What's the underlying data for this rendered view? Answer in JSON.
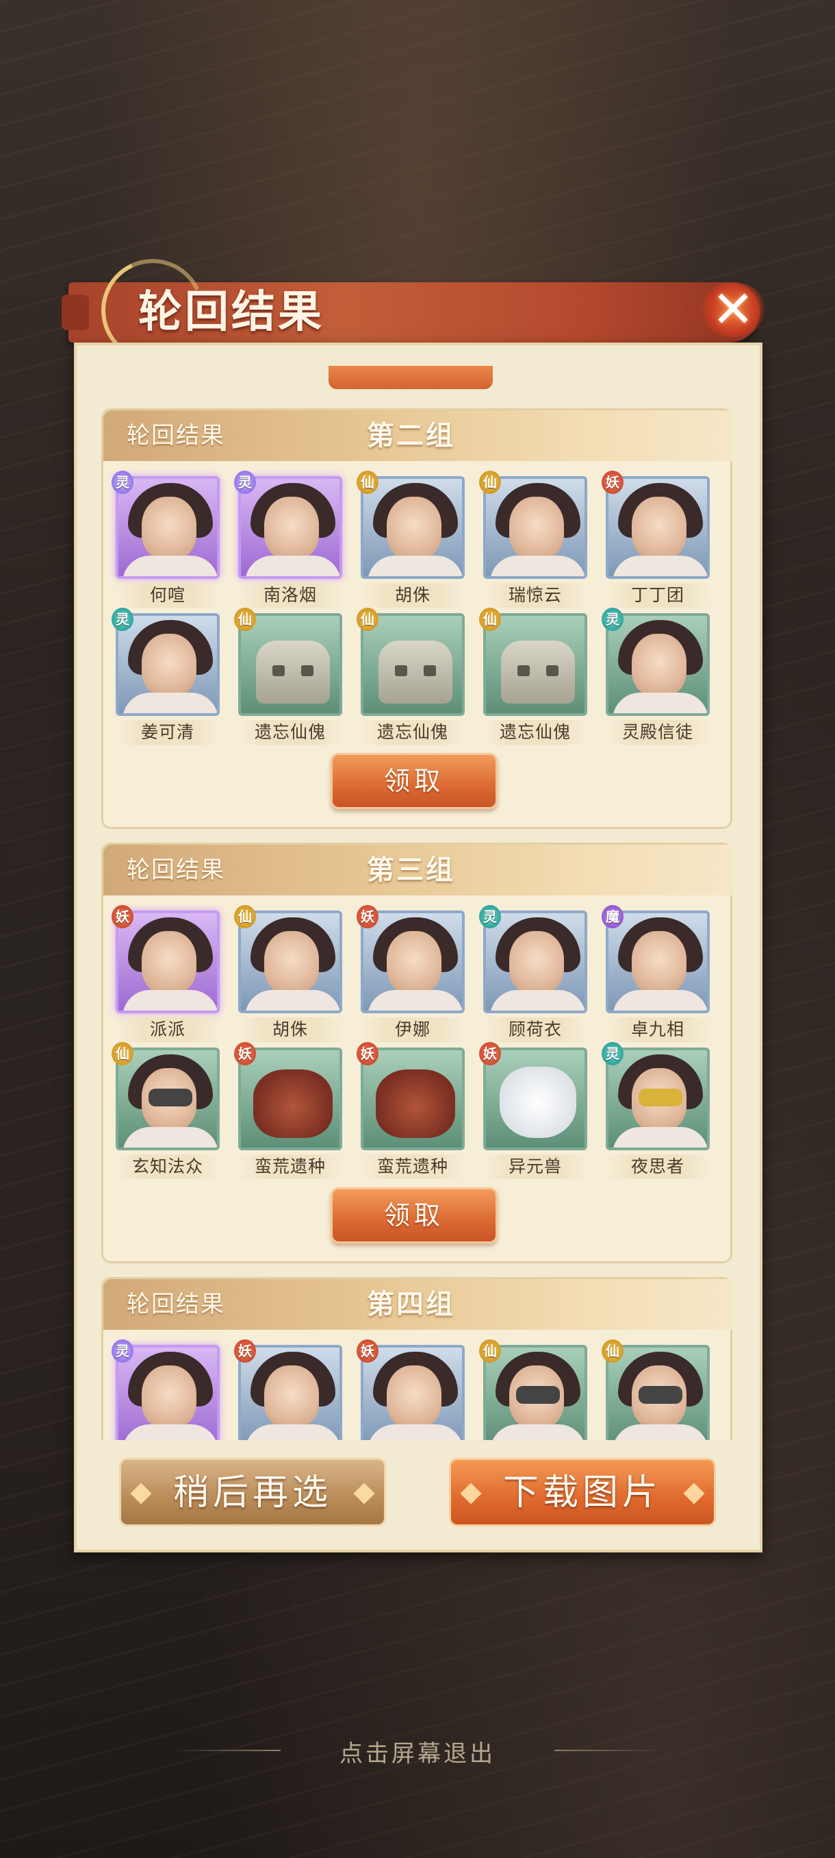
{
  "dialog": {
    "title": "轮回结果",
    "close_icon": "close-x-icon"
  },
  "groups": [
    {
      "label": "轮回结果",
      "name": "第二组",
      "claim_label": "领取",
      "cards": [
        {
          "name": "何喧",
          "badge": "sparkle",
          "frame": "purple",
          "art": "person"
        },
        {
          "name": "南洛烟",
          "badge": "sparkle",
          "frame": "purple",
          "art": "person"
        },
        {
          "name": "胡侏",
          "badge": "xian",
          "frame": "blue",
          "art": "person"
        },
        {
          "name": "瑞惊云",
          "badge": "xian",
          "frame": "blue",
          "art": "person"
        },
        {
          "name": "丁丁团",
          "badge": "yao",
          "frame": "blue",
          "art": "person"
        },
        {
          "name": "姜可清",
          "badge": "ling",
          "frame": "blue",
          "art": "person"
        },
        {
          "name": "遗忘仙傀",
          "badge": "xian",
          "frame": "green",
          "art": "golem"
        },
        {
          "name": "遗忘仙傀",
          "badge": "xian",
          "frame": "green",
          "art": "golem"
        },
        {
          "name": "遗忘仙傀",
          "badge": "xian",
          "frame": "green",
          "art": "golem"
        },
        {
          "name": "灵殿信徒",
          "badge": "ling",
          "frame": "green",
          "art": "person"
        }
      ]
    },
    {
      "label": "轮回结果",
      "name": "第三组",
      "claim_label": "领取",
      "cards": [
        {
          "name": "派派",
          "badge": "yao",
          "frame": "purple",
          "art": "person"
        },
        {
          "name": "胡侏",
          "badge": "xian",
          "frame": "blue",
          "art": "person"
        },
        {
          "name": "伊娜",
          "badge": "yao",
          "frame": "blue",
          "art": "person"
        },
        {
          "name": "顾荷衣",
          "badge": "ling",
          "frame": "blue",
          "art": "person"
        },
        {
          "name": "卓九相",
          "badge": "mo",
          "frame": "blue",
          "art": "person"
        },
        {
          "name": "玄知法众",
          "badge": "xian",
          "frame": "green",
          "art": "masked"
        },
        {
          "name": "蛮荒遗种",
          "badge": "yao",
          "frame": "green",
          "art": "beast"
        },
        {
          "name": "蛮荒遗种",
          "badge": "yao",
          "frame": "green",
          "art": "beast"
        },
        {
          "name": "异元兽",
          "badge": "yao",
          "frame": "green",
          "art": "wolf"
        },
        {
          "name": "夜思者",
          "badge": "ling",
          "frame": "green",
          "art": "masked-gold"
        }
      ]
    },
    {
      "label": "轮回结果",
      "name": "第四组",
      "cards": [
        {
          "name": "",
          "badge": "sparkle",
          "frame": "purple",
          "art": "person"
        },
        {
          "name": "",
          "badge": "yao",
          "frame": "blue",
          "art": "person"
        },
        {
          "name": "",
          "badge": "yao",
          "frame": "blue",
          "art": "person"
        },
        {
          "name": "",
          "badge": "xian",
          "frame": "green",
          "art": "masked"
        },
        {
          "name": "",
          "badge": "xian",
          "frame": "green",
          "art": "masked"
        }
      ]
    }
  ],
  "badges": {
    "xian": "仙",
    "yao": "妖",
    "ling": "灵",
    "mo": "魔",
    "sparkle": "灵"
  },
  "footer": {
    "later_label": "稍后再选",
    "download_label": "下载图片"
  },
  "exit_hint": "点击屏幕退出"
}
